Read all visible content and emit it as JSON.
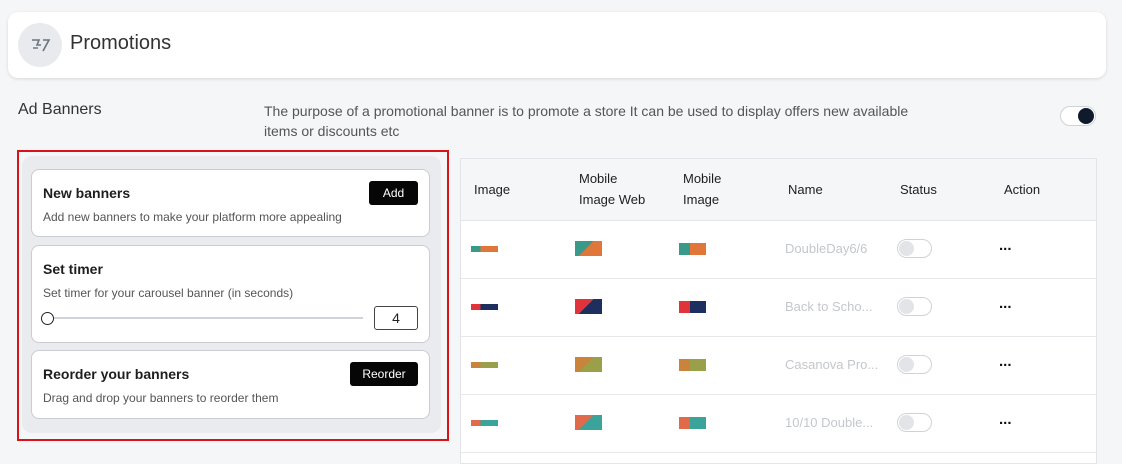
{
  "header": {
    "title": "Promotions",
    "icon": "promo-tag-icon"
  },
  "ad_banners": {
    "label": "Ad Banners",
    "description": "The purpose of a promotional banner is to promote a store It can be used to display offers new available items or discounts etc",
    "enabled": true
  },
  "settings": {
    "new_banners": {
      "title": "New banners",
      "description": "Add new banners to make your platform more appealing",
      "button": "Add"
    },
    "set_timer": {
      "title": "Set timer",
      "description": "Set timer for your carousel banner (in seconds)",
      "value": "4"
    },
    "reorder": {
      "title": "Reorder your banners",
      "description": "Drag and drop your banners to reorder them",
      "button": "Reorder"
    }
  },
  "table": {
    "headers": {
      "image": "Image",
      "mobile_web_1": "Mobile",
      "mobile_web_2": "Image Web",
      "mobile_image_1": "Mobile",
      "mobile_image_2": "Image",
      "name": "Name",
      "status": "Status",
      "action": "Action"
    },
    "rows": [
      {
        "name": "DoubleDay6/6",
        "status": false,
        "action": "...",
        "colors": [
          "#e0763a",
          "#3a9a8a"
        ]
      },
      {
        "name": "Back to Scho...",
        "status": false,
        "action": "...",
        "colors": [
          "#1c2f5e",
          "#e0343a"
        ]
      },
      {
        "name": "Casanova Pro...",
        "status": false,
        "action": "...",
        "colors": [
          "#9aa04a",
          "#c9833a"
        ]
      },
      {
        "name": "10/10 Double...",
        "status": false,
        "action": "...",
        "colors": [
          "#3aa39a",
          "#e06a4a"
        ]
      }
    ]
  }
}
